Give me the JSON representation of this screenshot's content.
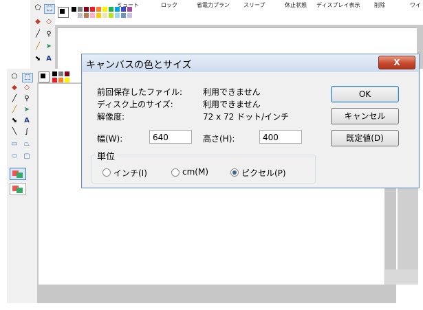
{
  "top_menu": [
    "ミュート",
    "ロック",
    "省電力プラン",
    "スリープ",
    "休止状態",
    "ディスプレイ表示",
    "削除",
    "ワイ"
  ],
  "palette_colors": [
    "#000000",
    "#7f7f7f",
    "#880015",
    "#ed1c24",
    "#ff7f27",
    "#fff200",
    "#22b14c",
    "#00a2e8",
    "#3f48cc",
    "#a349a4",
    "#ffffff",
    "#c3c3c3",
    "#b97a57",
    "#ffaec9",
    "#ffc90e",
    "#efe4b0",
    "#b5e61d",
    "#99d9ea",
    "#7092be",
    "#c8bfe7"
  ],
  "dialog": {
    "title": "キャンバスの色とサイズ",
    "close_label": "X",
    "info": {
      "last_saved_label": "前回保存したファイル:",
      "last_saved_value": "利用できません",
      "disk_size_label": "ディスク上のサイズ:",
      "disk_size_value": "利用できません",
      "resolution_label": "解像度:",
      "resolution_value": "72 x 72 ドット/インチ"
    },
    "width_label": "幅(W):",
    "width_value": "640",
    "height_label": "高さ(H):",
    "height_value": "400",
    "unit_group_label": "単位",
    "units": {
      "inch": "インチ(I)",
      "cm": "cm(M)",
      "pixel": "ピクセル(P)"
    },
    "selected_unit": "pixel",
    "buttons": {
      "ok": "OK",
      "cancel": "キャンセル",
      "default": "既定値(D)"
    }
  },
  "icons": [
    "select-icon",
    "rect-select-icon",
    "eraser-icon",
    "fill-icon",
    "eyedropper-icon",
    "magnifier-icon",
    "pencil-icon",
    "brush-icon",
    "airbrush-icon",
    "text-icon",
    "line-icon",
    "curve-icon",
    "rectangle-icon",
    "polygon-icon",
    "ellipse-icon",
    "rounded-rect-icon",
    "color-icon"
  ]
}
